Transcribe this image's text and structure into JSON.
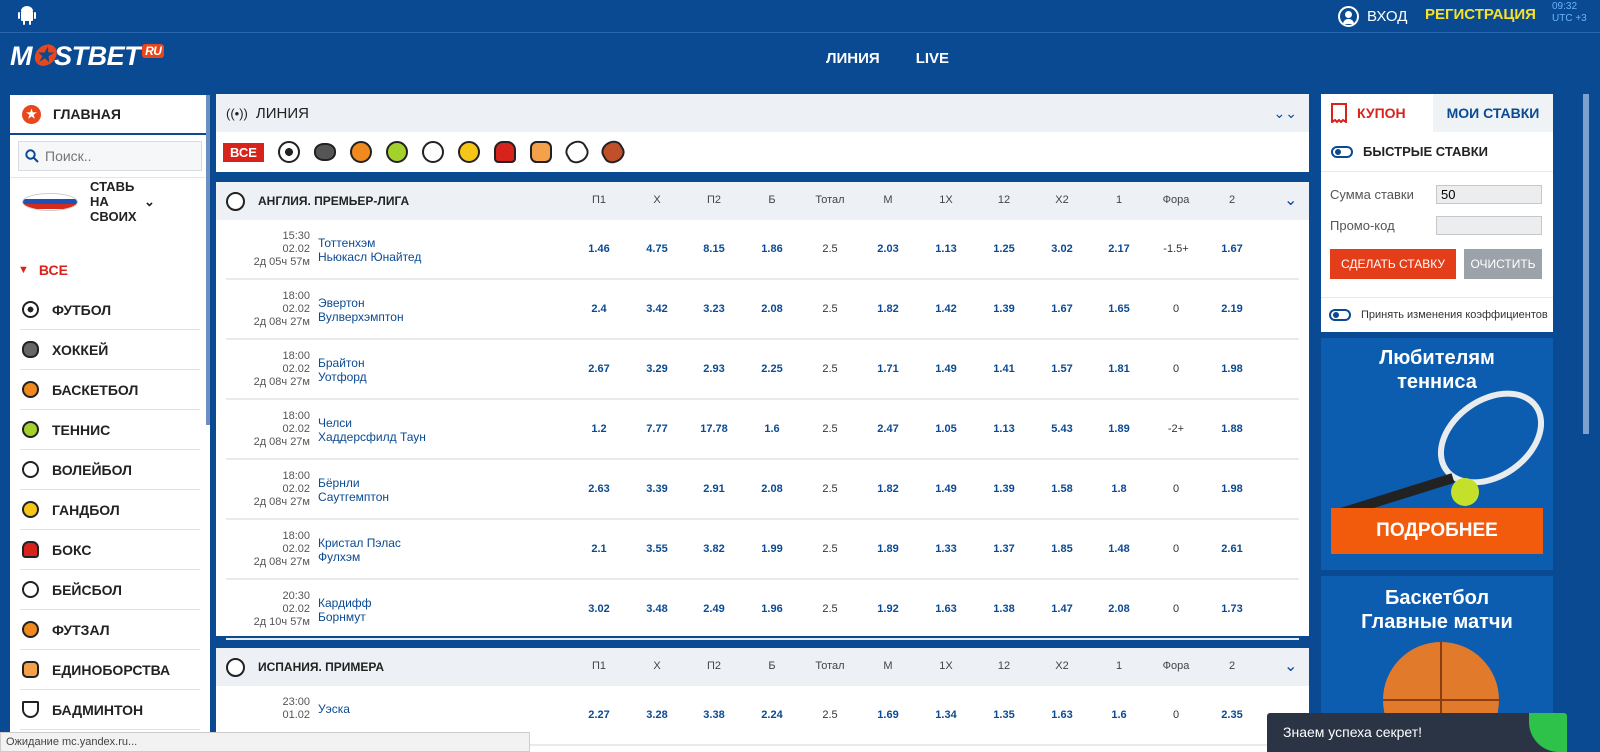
{
  "header": {
    "login": "ВХОД",
    "register": "РЕГИСТРАЦИЯ",
    "time": "09:32",
    "tz": "UTC +3"
  },
  "logo": {
    "text_a": "M",
    "text_b": "STBET",
    "ru": "RU"
  },
  "nav": [
    "ЛИНИЯ",
    "LIVE"
  ],
  "sidebar": {
    "home": "ГЛАВНАЯ",
    "search_placeholder": "Поиск..",
    "region": "СТАВЬ НА СВОИХ",
    "all": "ВСЕ",
    "sports": [
      {
        "label": "ФУТБОЛ",
        "icon": "football-icon"
      },
      {
        "label": "ХОККЕЙ",
        "icon": "hockey-icon"
      },
      {
        "label": "БАСКЕТБОЛ",
        "icon": "basketball-icon"
      },
      {
        "label": "ТЕННИС",
        "icon": "tennis-icon"
      },
      {
        "label": "ВОЛЕЙБОЛ",
        "icon": "volleyball-icon"
      },
      {
        "label": "ГАНДБОЛ",
        "icon": "handball-icon"
      },
      {
        "label": "БОКС",
        "icon": "boxing-icon"
      },
      {
        "label": "БЕЙСБОЛ",
        "icon": "baseball-icon"
      },
      {
        "label": "ФУТЗАЛ",
        "icon": "futsal-icon"
      },
      {
        "label": "ЕДИНОБОРСТВА",
        "icon": "martial-arts-icon"
      },
      {
        "label": "БАДМИНТОН",
        "icon": "badminton-icon"
      }
    ]
  },
  "line": {
    "title": "ЛИНИЯ",
    "all_btn": "ВСЕ"
  },
  "columns": [
    "П1",
    "Х",
    "П2",
    "Б",
    "Тотал",
    "М",
    "1Х",
    "12",
    "Х2",
    "1",
    "Фора",
    "2"
  ],
  "leagues": [
    {
      "name": "АНГЛИЯ. ПРЕМЬЕР-ЛИГА",
      "events": [
        {
          "time": "15:30",
          "date": "02.02",
          "left": "2д 05ч 57м",
          "home": "Тоттенхэм",
          "away": "Ньюкасл Юнайтед",
          "odds": [
            "1.46",
            "4.75",
            "8.15",
            "1.86",
            "2.5",
            "2.03",
            "1.13",
            "1.25",
            "3.02",
            "2.17",
            "-1.5+",
            "1.67"
          ]
        },
        {
          "time": "18:00",
          "date": "02.02",
          "left": "2д 08ч 27м",
          "home": "Эвертон",
          "away": "Вулверхэмптон",
          "odds": [
            "2.4",
            "3.42",
            "3.23",
            "2.08",
            "2.5",
            "1.82",
            "1.42",
            "1.39",
            "1.67",
            "1.65",
            "0",
            "2.19"
          ]
        },
        {
          "time": "18:00",
          "date": "02.02",
          "left": "2д 08ч 27м",
          "home": "Брайтон",
          "away": "Уотфорд",
          "odds": [
            "2.67",
            "3.29",
            "2.93",
            "2.25",
            "2.5",
            "1.71",
            "1.49",
            "1.41",
            "1.57",
            "1.81",
            "0",
            "1.98"
          ]
        },
        {
          "time": "18:00",
          "date": "02.02",
          "left": "2д 08ч 27м",
          "home": "Челси",
          "away": "Хаддерсфилд Таун",
          "odds": [
            "1.2",
            "7.77",
            "17.78",
            "1.6",
            "2.5",
            "2.47",
            "1.05",
            "1.13",
            "5.43",
            "1.89",
            "-2+",
            "1.88"
          ]
        },
        {
          "time": "18:00",
          "date": "02.02",
          "left": "2д 08ч 27м",
          "home": "Бёрнли",
          "away": "Саутгемптон",
          "odds": [
            "2.63",
            "3.39",
            "2.91",
            "2.08",
            "2.5",
            "1.82",
            "1.49",
            "1.39",
            "1.58",
            "1.8",
            "0",
            "1.98"
          ]
        },
        {
          "time": "18:00",
          "date": "02.02",
          "left": "2д 08ч 27м",
          "home": "Кристал Пэлас",
          "away": "Фулхэм",
          "odds": [
            "2.1",
            "3.55",
            "3.82",
            "1.99",
            "2.5",
            "1.89",
            "1.33",
            "1.37",
            "1.85",
            "1.48",
            "0",
            "2.61"
          ]
        },
        {
          "time": "20:30",
          "date": "02.02",
          "left": "2д 10ч 57м",
          "home": "Кардифф",
          "away": "Борнмут",
          "odds": [
            "3.02",
            "3.48",
            "2.49",
            "1.96",
            "2.5",
            "1.92",
            "1.63",
            "1.38",
            "1.47",
            "2.08",
            "0",
            "1.73"
          ]
        }
      ]
    },
    {
      "name": "ИСПАНИЯ. ПРИМЕРА",
      "events": [
        {
          "time": "23:00",
          "date": "01.02",
          "left": "",
          "home": "Уэска",
          "away": "",
          "odds": [
            "2.27",
            "3.28",
            "3.38",
            "2.24",
            "2.5",
            "1.69",
            "1.34",
            "1.35",
            "1.63",
            "1.6",
            "0",
            "2.35"
          ]
        }
      ]
    }
  ],
  "coupon": {
    "tab_coupon": "КУПОН",
    "tab_mybets": "МОИ СТАВКИ",
    "fast": "БЫСТРЫЕ СТАВКИ",
    "sum_label": "Сумма ставки",
    "sum_value": "50",
    "promo_label": "Промо-код",
    "bet_btn": "СДЕЛАТЬ СТАВКУ",
    "clear_btn": "ОЧИСТИТЬ",
    "accept": "Принять изменения коэффициентов"
  },
  "promos": [
    {
      "line1": "Любителям",
      "line2": "тенниса",
      "button": "ПОДРОБНЕЕ"
    },
    {
      "line1": "Баскетбол",
      "line2": "Главные матчи"
    }
  ],
  "status": "Ожидание mc.yandex.ru...",
  "chat": "Знаем успеха секрет!",
  "colors": {
    "brand": "#0a4a92",
    "accent": "#d6231c",
    "register": "#f7e12a"
  }
}
